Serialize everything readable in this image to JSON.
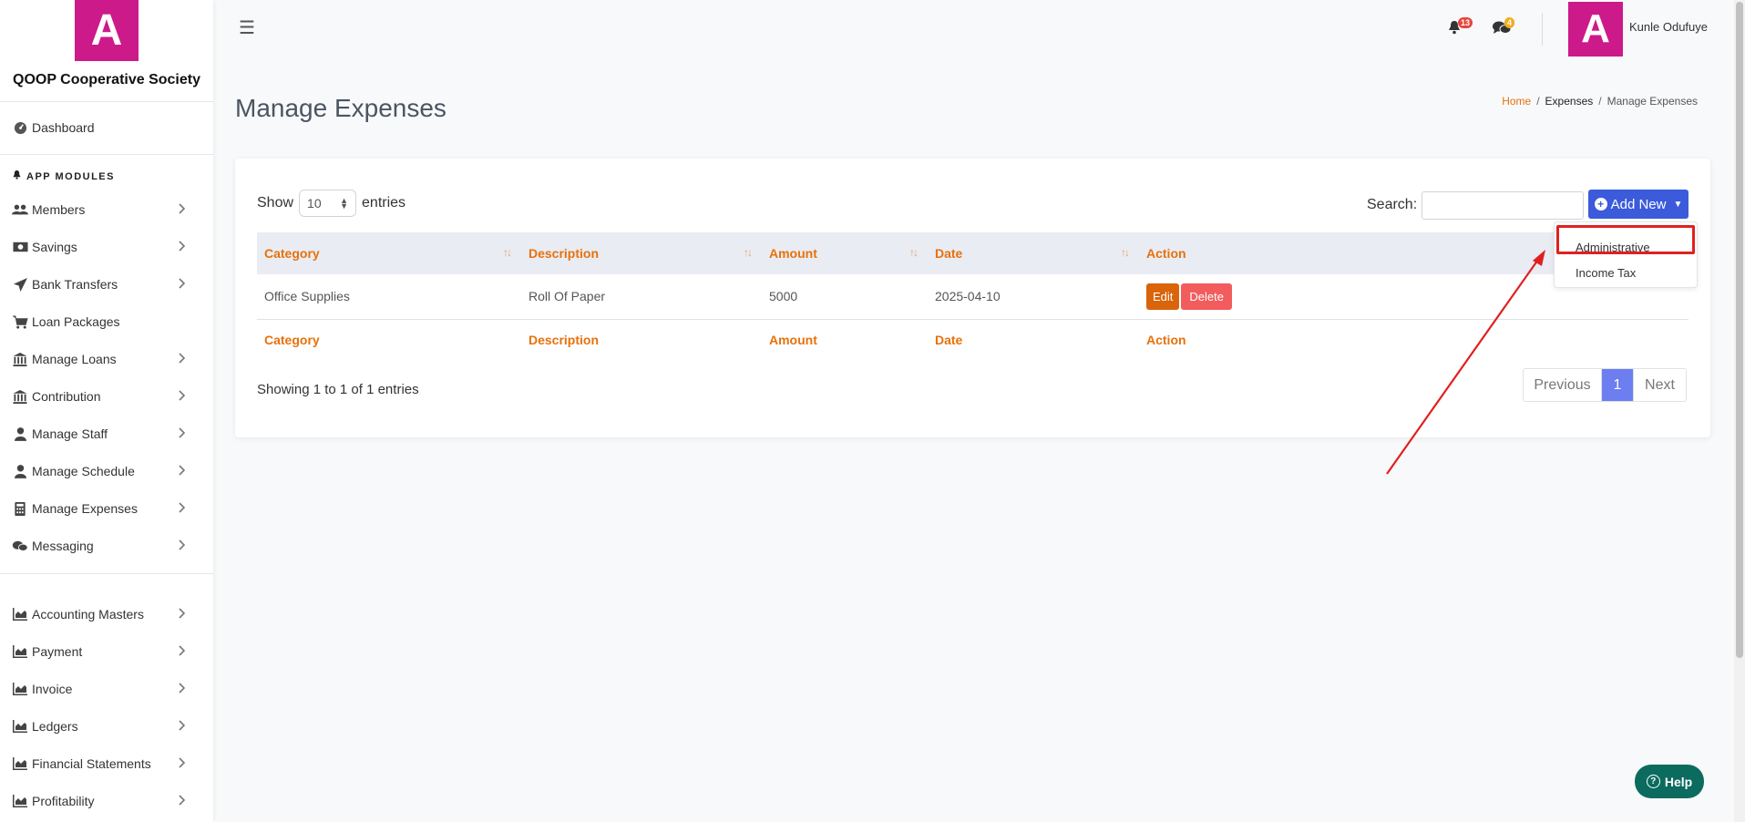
{
  "brand": {
    "logo_letter": "A",
    "name": "QOOP Cooperative Society",
    "color": "#cc1a8a"
  },
  "sidebar": {
    "dashboard": "Dashboard",
    "section_label": "APP MODULES",
    "items": [
      {
        "label": "Members",
        "icon": "users-icon"
      },
      {
        "label": "Savings",
        "icon": "money-icon"
      },
      {
        "label": "Bank Transfers",
        "icon": "paper-plane-icon"
      },
      {
        "label": "Loan Packages",
        "icon": "cart-icon"
      },
      {
        "label": "Manage Loans",
        "icon": "bank-icon"
      },
      {
        "label": "Contribution",
        "icon": "bank-icon"
      },
      {
        "label": "Manage Staff",
        "icon": "user-icon"
      },
      {
        "label": "Manage Schedule",
        "icon": "user-icon"
      },
      {
        "label": "Manage Expenses",
        "icon": "calculator-icon"
      },
      {
        "label": "Messaging",
        "icon": "comments-icon"
      }
    ],
    "items2": [
      {
        "label": "Accounting Masters",
        "icon": "chart-area-icon"
      },
      {
        "label": "Payment",
        "icon": "chart-area-icon"
      },
      {
        "label": "Invoice",
        "icon": "chart-area-icon"
      },
      {
        "label": "Ledgers",
        "icon": "chart-area-icon"
      },
      {
        "label": "Financial Statements",
        "icon": "chart-area-icon"
      },
      {
        "label": "Profitability",
        "icon": "chart-area-icon"
      }
    ]
  },
  "topbar": {
    "notifications_count": "13",
    "messages_count": "4",
    "avatar_letter": "A",
    "user_name": "Kunle Odufuye"
  },
  "page": {
    "title": "Manage Expenses",
    "breadcrumb": {
      "home": "Home",
      "section": "Expenses",
      "current": "Manage Expenses"
    }
  },
  "table_controls": {
    "show_label": "Show",
    "entries_label": "entries",
    "page_length": "10",
    "search_label": "Search:",
    "search_value": "",
    "add_new_label": "Add New"
  },
  "dropdown": {
    "items": [
      "Administrative",
      "Income Tax"
    ]
  },
  "table": {
    "columns": [
      "Category",
      "Description",
      "Amount",
      "Date",
      "Action"
    ],
    "rows": [
      {
        "category": "Office Supplies",
        "description": "Roll Of Paper",
        "amount": "5000",
        "date": "2025-04-10"
      }
    ],
    "edit_label": "Edit",
    "delete_label": "Delete"
  },
  "pagination": {
    "info": "Showing 1 to 1 of 1 entries",
    "previous": "Previous",
    "current": "1",
    "next": "Next"
  },
  "help_label": "Help",
  "colors": {
    "accent": "#e8710a",
    "primary": "#3b5bdb",
    "annotation": "#e02020"
  }
}
